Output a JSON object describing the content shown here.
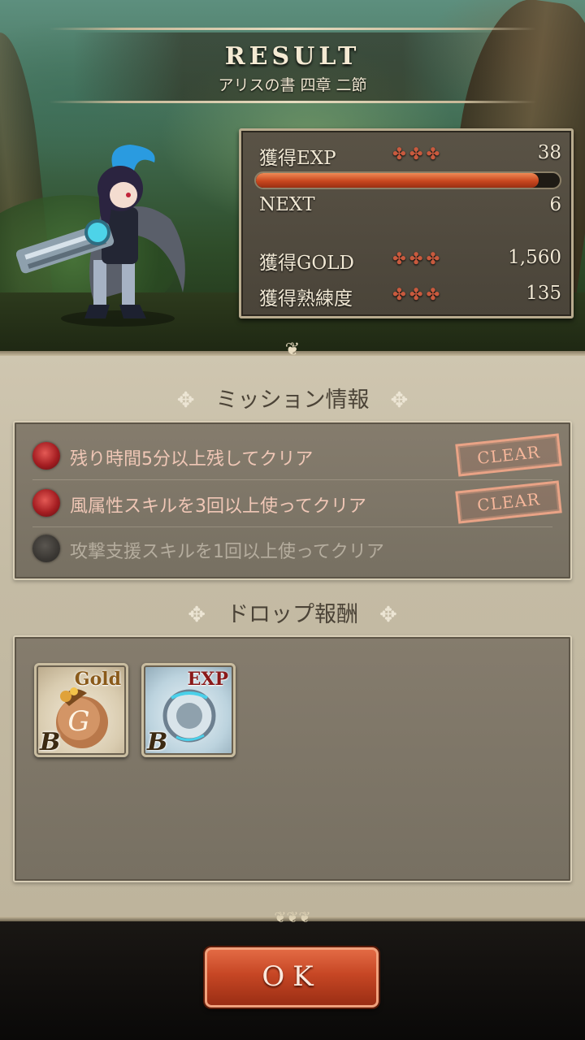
{
  "header": {
    "title": "RESULT",
    "chapter": "アリスの書 四章 二節"
  },
  "stats": {
    "exp_label": "獲得EXP",
    "exp_value": "38",
    "exp_progress": 0.93,
    "next_label": "NEXT",
    "next_value": "6",
    "gold_label": "獲得GOLD",
    "gold_value": "1,560",
    "mastery_label": "獲得熟練度",
    "mastery_value": "135",
    "ornament": "✤✤✤"
  },
  "missions": {
    "heading": "ミッション情報",
    "items": [
      {
        "text": "残り時間5分以上残してクリア",
        "status": "CLEAR",
        "cleared": true
      },
      {
        "text": "風属性スキルを3回以上使ってクリア",
        "status": "CLEAR",
        "cleared": true
      },
      {
        "text": "攻撃支援スキルを1回以上使ってクリア",
        "status": "",
        "cleared": false
      }
    ]
  },
  "drops": {
    "heading": "ドロップ報酬",
    "items": [
      {
        "kind": "Gold",
        "grade": "B",
        "icon": "gold-bag-icon"
      },
      {
        "kind": "EXP",
        "grade": "B",
        "icon": "exp-orb-icon"
      }
    ]
  },
  "actions": {
    "ok_label": "OK"
  },
  "colors": {
    "accent": "#c64624",
    "cleared_text": "#f0c7b6",
    "stamp": "#e9a386"
  }
}
